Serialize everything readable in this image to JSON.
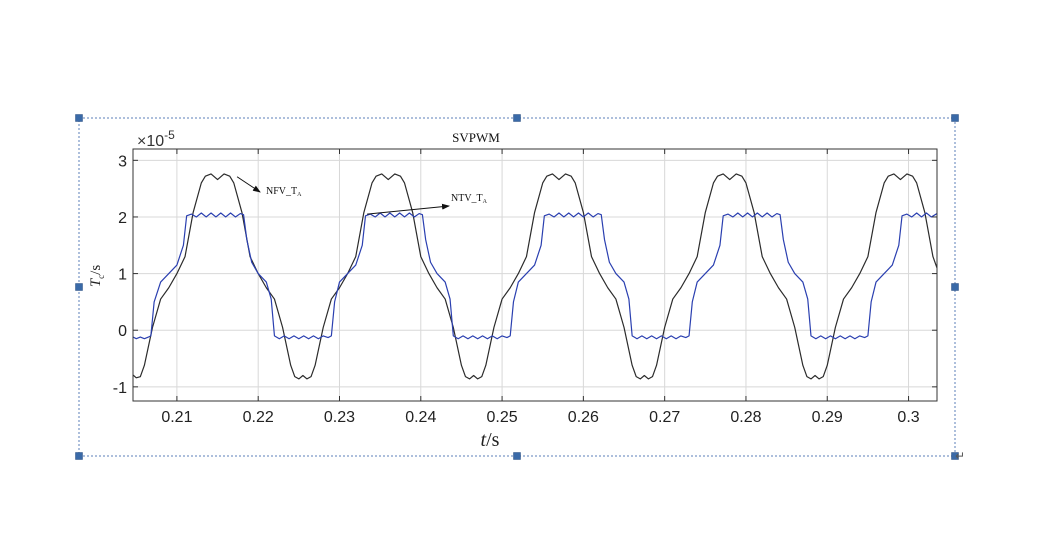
{
  "chart_data": {
    "type": "line",
    "title": "SVPWM",
    "xlabel": "t/s",
    "ylabel_main": "T",
    "ylabel_sub": "c",
    "ylabel_unit": "/s",
    "y_multiplier": "×10",
    "y_exponent": "-5",
    "xlim": [
      0.2046,
      0.3035
    ],
    "ylim": [
      -1.25,
      3.2
    ],
    "x_ticks": [
      "0.21",
      "0.22",
      "0.23",
      "0.24",
      "0.25",
      "0.26",
      "0.27",
      "0.28",
      "0.29",
      "0.3"
    ],
    "y_ticks": [
      "-1",
      "0",
      "1",
      "2",
      "3"
    ],
    "grid": true,
    "annotations": [
      {
        "text": "NFV_T",
        "sub": "A",
        "arrow_to_x": 0.2174,
        "arrow_to_y": 2.71
      },
      {
        "text": "NTV_T",
        "sub": "A",
        "arrow_to_x": 0.2334,
        "arrow_to_y": 2.05
      }
    ],
    "series": [
      {
        "color": "#2b2b2b",
        "period": 0.02,
        "phase_zero_cross": 0.21,
        "points": [
          [
            0.2046,
            -0.79
          ],
          [
            0.205,
            -0.84
          ],
          [
            0.2055,
            -0.82
          ],
          [
            0.206,
            -0.62
          ],
          [
            0.207,
            0.05
          ],
          [
            0.208,
            0.55
          ],
          [
            0.209,
            0.75
          ],
          [
            0.21,
            1.0
          ],
          [
            0.211,
            1.3
          ],
          [
            0.212,
            2.08
          ],
          [
            0.213,
            2.6
          ],
          [
            0.2135,
            2.72
          ],
          [
            0.2142,
            2.76
          ],
          [
            0.215,
            2.66
          ],
          [
            0.2158,
            2.76
          ],
          [
            0.2165,
            2.72
          ],
          [
            0.217,
            2.6
          ],
          [
            0.218,
            2.08
          ],
          [
            0.219,
            1.3
          ],
          [
            0.22,
            1.0
          ],
          [
            0.221,
            0.75
          ],
          [
            0.222,
            0.55
          ],
          [
            0.223,
            0.05
          ],
          [
            0.224,
            -0.62
          ],
          [
            0.2245,
            -0.82
          ],
          [
            0.225,
            -0.86
          ],
          [
            0.2255,
            -0.8
          ],
          [
            0.226,
            -0.86
          ],
          [
            0.2265,
            -0.82
          ],
          [
            0.227,
            -0.62
          ],
          [
            0.228,
            0.05
          ],
          [
            0.229,
            0.55
          ],
          [
            0.23,
            0.75
          ],
          [
            0.231,
            1.0
          ],
          [
            0.232,
            1.3
          ],
          [
            0.233,
            2.08
          ],
          [
            0.234,
            2.6
          ],
          [
            0.2345,
            2.72
          ],
          [
            0.2352,
            2.76
          ],
          [
            0.236,
            2.66
          ],
          [
            0.2368,
            2.76
          ],
          [
            0.2375,
            2.72
          ],
          [
            0.238,
            2.6
          ],
          [
            0.239,
            2.08
          ],
          [
            0.24,
            1.3
          ],
          [
            0.241,
            1.0
          ],
          [
            0.242,
            0.75
          ],
          [
            0.243,
            0.55
          ],
          [
            0.244,
            0.05
          ],
          [
            0.245,
            -0.62
          ],
          [
            0.2455,
            -0.82
          ],
          [
            0.246,
            -0.86
          ],
          [
            0.2465,
            -0.8
          ],
          [
            0.247,
            -0.86
          ],
          [
            0.2475,
            -0.82
          ],
          [
            0.248,
            -0.62
          ],
          [
            0.249,
            0.05
          ],
          [
            0.25,
            0.55
          ],
          [
            0.251,
            0.75
          ],
          [
            0.252,
            1.0
          ],
          [
            0.253,
            1.3
          ],
          [
            0.254,
            2.08
          ],
          [
            0.255,
            2.6
          ],
          [
            0.2555,
            2.72
          ],
          [
            0.2562,
            2.76
          ],
          [
            0.257,
            2.66
          ],
          [
            0.2578,
            2.76
          ],
          [
            0.2585,
            2.72
          ],
          [
            0.259,
            2.6
          ],
          [
            0.26,
            2.08
          ],
          [
            0.261,
            1.3
          ],
          [
            0.262,
            1.0
          ],
          [
            0.263,
            0.75
          ],
          [
            0.264,
            0.55
          ],
          [
            0.265,
            0.05
          ],
          [
            0.266,
            -0.62
          ],
          [
            0.2665,
            -0.82
          ],
          [
            0.267,
            -0.86
          ],
          [
            0.2675,
            -0.8
          ],
          [
            0.268,
            -0.86
          ],
          [
            0.2685,
            -0.82
          ],
          [
            0.269,
            -0.62
          ],
          [
            0.27,
            0.05
          ],
          [
            0.271,
            0.55
          ],
          [
            0.272,
            0.75
          ],
          [
            0.273,
            1.0
          ],
          [
            0.274,
            1.3
          ],
          [
            0.275,
            2.08
          ],
          [
            0.276,
            2.6
          ],
          [
            0.2765,
            2.72
          ],
          [
            0.2772,
            2.76
          ],
          [
            0.278,
            2.66
          ],
          [
            0.2788,
            2.76
          ],
          [
            0.2795,
            2.72
          ],
          [
            0.28,
            2.6
          ],
          [
            0.281,
            2.08
          ],
          [
            0.282,
            1.3
          ],
          [
            0.283,
            1.0
          ],
          [
            0.284,
            0.75
          ],
          [
            0.285,
            0.55
          ],
          [
            0.286,
            0.05
          ],
          [
            0.287,
            -0.62
          ],
          [
            0.2875,
            -0.82
          ],
          [
            0.288,
            -0.86
          ],
          [
            0.2885,
            -0.8
          ],
          [
            0.289,
            -0.86
          ],
          [
            0.2895,
            -0.82
          ],
          [
            0.29,
            -0.62
          ],
          [
            0.291,
            0.05
          ],
          [
            0.292,
            0.55
          ],
          [
            0.293,
            0.75
          ],
          [
            0.294,
            1.0
          ],
          [
            0.295,
            1.3
          ],
          [
            0.296,
            2.08
          ],
          [
            0.297,
            2.6
          ],
          [
            0.2975,
            2.72
          ],
          [
            0.2982,
            2.76
          ],
          [
            0.299,
            2.66
          ],
          [
            0.2998,
            2.76
          ],
          [
            0.3005,
            2.72
          ],
          [
            0.301,
            2.6
          ],
          [
            0.302,
            2.08
          ],
          [
            0.303,
            1.3
          ],
          [
            0.3035,
            1.1
          ]
        ]
      },
      {
        "color": "#2a3fb0",
        "points": [
          [
            0.2046,
            -0.12
          ],
          [
            0.205,
            -0.15
          ],
          [
            0.2055,
            -0.12
          ],
          [
            0.206,
            -0.15
          ],
          [
            0.2065,
            -0.12
          ],
          [
            0.2068,
            -0.1
          ],
          [
            0.2072,
            0.5
          ],
          [
            0.208,
            0.85
          ],
          [
            0.209,
            1.0
          ],
          [
            0.21,
            1.15
          ],
          [
            0.2108,
            1.5
          ],
          [
            0.2112,
            2.02
          ],
          [
            0.2118,
            2.05
          ],
          [
            0.2124,
            2.0
          ],
          [
            0.213,
            2.07
          ],
          [
            0.2136,
            2.0
          ],
          [
            0.2142,
            2.07
          ],
          [
            0.2148,
            2.0
          ],
          [
            0.2154,
            2.07
          ],
          [
            0.216,
            2.0
          ],
          [
            0.2166,
            2.07
          ],
          [
            0.2172,
            2.0
          ],
          [
            0.2178,
            2.06
          ],
          [
            0.2182,
            2.04
          ],
          [
            0.2186,
            1.6
          ],
          [
            0.2192,
            1.2
          ],
          [
            0.22,
            1.0
          ],
          [
            0.221,
            0.85
          ],
          [
            0.2216,
            0.55
          ],
          [
            0.222,
            -0.1
          ],
          [
            0.2226,
            -0.15
          ],
          [
            0.2232,
            -0.1
          ],
          [
            0.2238,
            -0.15
          ],
          [
            0.2244,
            -0.1
          ],
          [
            0.225,
            -0.15
          ],
          [
            0.2256,
            -0.1
          ],
          [
            0.2262,
            -0.15
          ],
          [
            0.2268,
            -0.1
          ],
          [
            0.2274,
            -0.15
          ],
          [
            0.228,
            -0.1
          ],
          [
            0.2286,
            -0.13
          ],
          [
            0.229,
            -0.1
          ],
          [
            0.2294,
            0.5
          ],
          [
            0.23,
            0.85
          ],
          [
            0.231,
            1.0
          ],
          [
            0.232,
            1.15
          ],
          [
            0.2328,
            1.5
          ],
          [
            0.2332,
            2.02
          ],
          [
            0.2338,
            2.05
          ],
          [
            0.2344,
            2.0
          ],
          [
            0.235,
            2.07
          ],
          [
            0.2356,
            2.0
          ],
          [
            0.2362,
            2.07
          ],
          [
            0.2368,
            2.0
          ],
          [
            0.2374,
            2.07
          ],
          [
            0.238,
            2.0
          ],
          [
            0.2386,
            2.07
          ],
          [
            0.2392,
            2.0
          ],
          [
            0.2398,
            2.06
          ],
          [
            0.2402,
            2.04
          ],
          [
            0.2406,
            1.6
          ],
          [
            0.2412,
            1.2
          ],
          [
            0.242,
            1.0
          ],
          [
            0.243,
            0.85
          ],
          [
            0.2436,
            0.55
          ],
          [
            0.244,
            -0.1
          ],
          [
            0.2446,
            -0.15
          ],
          [
            0.2452,
            -0.1
          ],
          [
            0.2458,
            -0.15
          ],
          [
            0.2464,
            -0.1
          ],
          [
            0.247,
            -0.15
          ],
          [
            0.2476,
            -0.1
          ],
          [
            0.2482,
            -0.15
          ],
          [
            0.2488,
            -0.1
          ],
          [
            0.2494,
            -0.15
          ],
          [
            0.25,
            -0.1
          ],
          [
            0.2506,
            -0.13
          ],
          [
            0.251,
            -0.1
          ],
          [
            0.2514,
            0.5
          ],
          [
            0.252,
            0.85
          ],
          [
            0.253,
            1.0
          ],
          [
            0.254,
            1.15
          ],
          [
            0.2548,
            1.5
          ],
          [
            0.2552,
            2.02
          ],
          [
            0.2558,
            2.05
          ],
          [
            0.2564,
            2.0
          ],
          [
            0.257,
            2.07
          ],
          [
            0.2576,
            2.0
          ],
          [
            0.2582,
            2.07
          ],
          [
            0.2588,
            2.0
          ],
          [
            0.2594,
            2.07
          ],
          [
            0.26,
            2.0
          ],
          [
            0.2606,
            2.07
          ],
          [
            0.2612,
            2.0
          ],
          [
            0.2618,
            2.06
          ],
          [
            0.2622,
            2.04
          ],
          [
            0.2626,
            1.6
          ],
          [
            0.2632,
            1.2
          ],
          [
            0.264,
            1.0
          ],
          [
            0.265,
            0.85
          ],
          [
            0.2656,
            0.55
          ],
          [
            0.266,
            -0.1
          ],
          [
            0.2666,
            -0.15
          ],
          [
            0.2672,
            -0.1
          ],
          [
            0.2678,
            -0.15
          ],
          [
            0.2684,
            -0.1
          ],
          [
            0.269,
            -0.15
          ],
          [
            0.2696,
            -0.1
          ],
          [
            0.2702,
            -0.15
          ],
          [
            0.2708,
            -0.1
          ],
          [
            0.2714,
            -0.15
          ],
          [
            0.272,
            -0.1
          ],
          [
            0.2726,
            -0.13
          ],
          [
            0.273,
            -0.1
          ],
          [
            0.2734,
            0.5
          ],
          [
            0.274,
            0.85
          ],
          [
            0.275,
            1.0
          ],
          [
            0.276,
            1.15
          ],
          [
            0.2768,
            1.5
          ],
          [
            0.2772,
            2.02
          ],
          [
            0.2778,
            2.05
          ],
          [
            0.2784,
            2.0
          ],
          [
            0.279,
            2.07
          ],
          [
            0.2796,
            2.0
          ],
          [
            0.2802,
            2.07
          ],
          [
            0.2808,
            2.0
          ],
          [
            0.2814,
            2.07
          ],
          [
            0.282,
            2.0
          ],
          [
            0.2826,
            2.07
          ],
          [
            0.2832,
            2.0
          ],
          [
            0.2838,
            2.06
          ],
          [
            0.2842,
            2.04
          ],
          [
            0.2846,
            1.6
          ],
          [
            0.2852,
            1.2
          ],
          [
            0.286,
            1.0
          ],
          [
            0.287,
            0.85
          ],
          [
            0.2876,
            0.55
          ],
          [
            0.288,
            -0.1
          ],
          [
            0.2886,
            -0.15
          ],
          [
            0.2892,
            -0.1
          ],
          [
            0.2898,
            -0.15
          ],
          [
            0.2904,
            -0.1
          ],
          [
            0.291,
            -0.15
          ],
          [
            0.2916,
            -0.1
          ],
          [
            0.2922,
            -0.15
          ],
          [
            0.2928,
            -0.1
          ],
          [
            0.2934,
            -0.15
          ],
          [
            0.294,
            -0.1
          ],
          [
            0.2946,
            -0.13
          ],
          [
            0.295,
            -0.1
          ],
          [
            0.2954,
            0.5
          ],
          [
            0.296,
            0.85
          ],
          [
            0.297,
            1.0
          ],
          [
            0.298,
            1.15
          ],
          [
            0.2988,
            1.5
          ],
          [
            0.2992,
            2.02
          ],
          [
            0.2998,
            2.05
          ],
          [
            0.3004,
            2.0
          ],
          [
            0.301,
            2.07
          ],
          [
            0.3016,
            2.0
          ],
          [
            0.3022,
            2.07
          ],
          [
            0.3028,
            2.0
          ],
          [
            0.3035,
            2.06
          ]
        ]
      }
    ]
  }
}
